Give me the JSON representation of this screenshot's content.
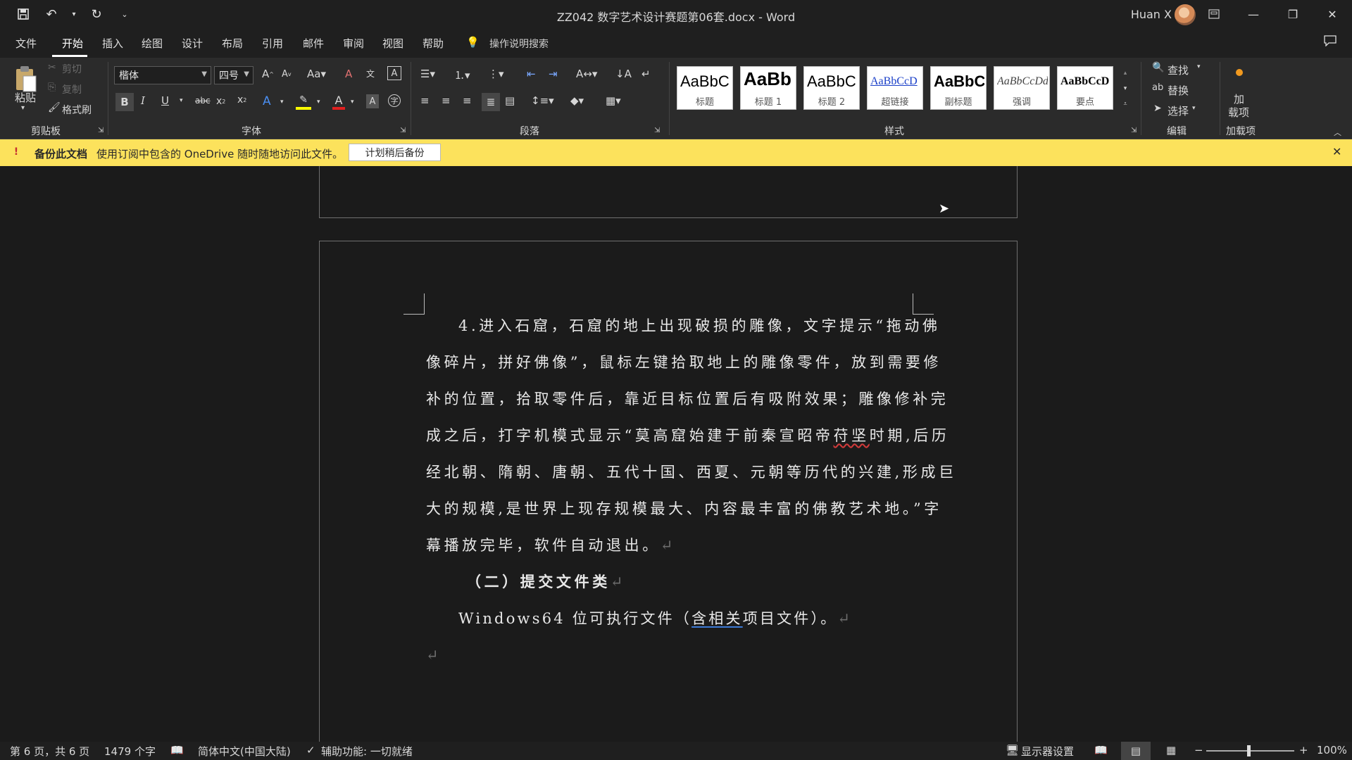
{
  "window": {
    "title": "ZZ042 数字艺术设计赛题第06套.docx  -  Word",
    "user": "Huan X"
  },
  "tabs": [
    "文件",
    "开始",
    "插入",
    "绘图",
    "设计",
    "布局",
    "引用",
    "邮件",
    "审阅",
    "视图",
    "帮助"
  ],
  "tell_me": "操作说明搜索",
  "ribbon": {
    "clipboard": {
      "paste": "粘贴",
      "cut": "剪切",
      "copy": "复制",
      "format_painter": "格式刷",
      "group": "剪贴板"
    },
    "font": {
      "family": "楷体",
      "size": "四号",
      "group": "字体"
    },
    "paragraph": {
      "group": "段落"
    },
    "styles": {
      "group": "样式",
      "cards": [
        {
          "sample": "AaBbC",
          "label": "标题"
        },
        {
          "sample": "AaBb",
          "label": "标题 1"
        },
        {
          "sample": "AaBbC",
          "label": "标题 2"
        },
        {
          "sample": "AaBbCcD",
          "label": "超链接"
        },
        {
          "sample": "AaBbC",
          "label": "副标题"
        },
        {
          "sample": "AaBbCcDd",
          "label": "强调"
        },
        {
          "sample": "AaBbCcD",
          "label": "要点"
        }
      ]
    },
    "editing": {
      "find": "查找",
      "replace": "替换",
      "select": "选择",
      "group": "编辑"
    },
    "addins": {
      "label_top": "加",
      "label_bottom": "载项",
      "group": "加载项"
    }
  },
  "infobar": {
    "title": "备份此文档",
    "message": "使用订阅中包含的 OneDrive 随时随地访问此文件。",
    "button": "计划稍后备份"
  },
  "document": {
    "lines": [
      "4.进入石窟，石窟的地上出现破损的雕像，文字提示“拖动佛",
      "像碎片，拼好佛像”，鼠标左键拾取地上的雕像零件，放到需要修",
      "补的位置，拾取零件后，靠近目标位置后有吸附效果；雕像修补完",
      "成之后，打字机模式显示“莫高窟始建于前秦宣昭帝",
      "苻坚",
      "时期,后历",
      "经北朝、隋朝、唐朝、五代十国、西夏、元朝等历代的兴建,形成巨",
      "大的规模,是世界上现存规模最大、内容最丰富的佛教艺术地。”字",
      "幕播放完毕，软件自动退出。"
    ],
    "heading": "（二）提交文件类",
    "deliverable_a": "Windows64 位可执行文件（",
    "deliverable_b": "含相关",
    "deliverable_c": "项目文件）。",
    "para_mark": "↵"
  },
  "status": {
    "page": "第 6 页，共 6 页",
    "words": "1479 个字",
    "language": "简体中文(中国大陆)",
    "accessibility": "辅助功能: 一切就绪",
    "display": "显示器设置",
    "zoom": "100%"
  }
}
